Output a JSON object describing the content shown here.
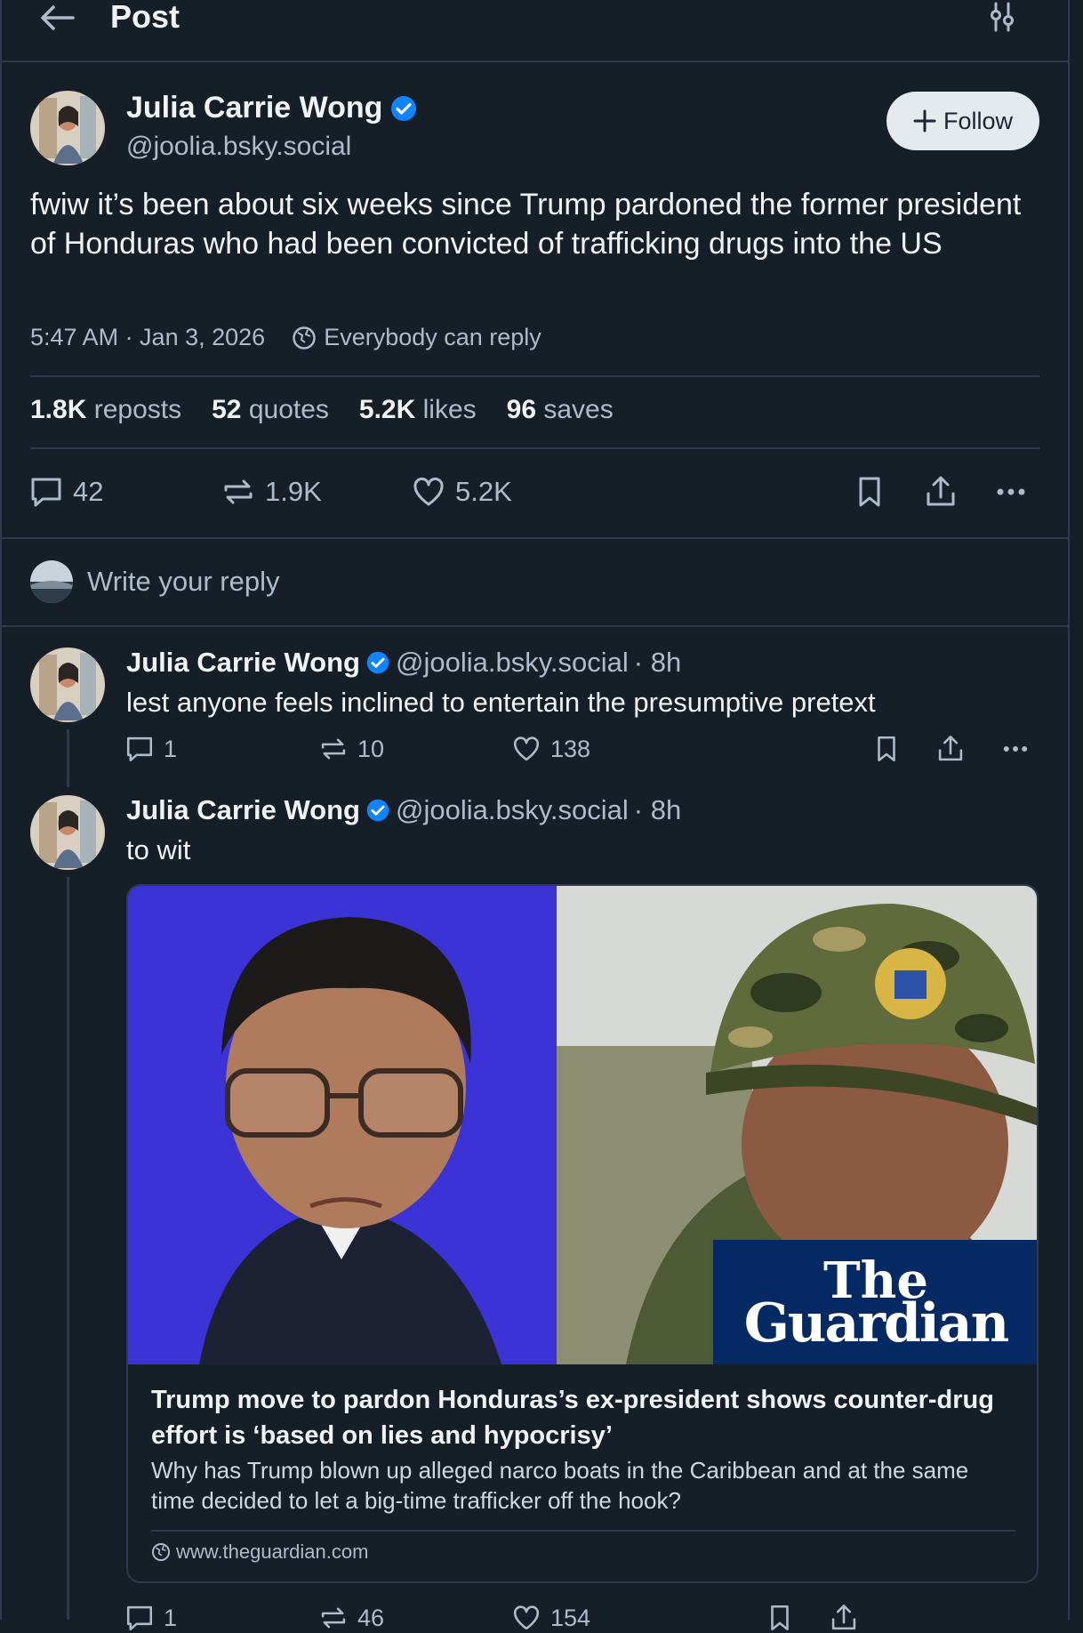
{
  "header": {
    "title": "Post"
  },
  "post": {
    "author_name": "Julia Carrie Wong",
    "author_handle": "@joolia.bsky.social",
    "follow_label": "Follow",
    "text": "fwiw it’s been about six weeks since Trump pardoned the former president of Honduras who had been convicted  of trafficking drugs into the US",
    "timestamp": "5:47 AM · Jan 3, 2026",
    "reply_setting": "Everybody can reply",
    "stats": {
      "reposts_count": "1.8K",
      "reposts_label": "reposts",
      "quotes_count": "52",
      "quotes_label": "quotes",
      "likes_count": "5.2K",
      "likes_label": "likes",
      "saves_count": "96",
      "saves_label": "saves"
    },
    "actions": {
      "replies": "42",
      "reposts": "1.9K",
      "likes": "5.2K"
    }
  },
  "compose": {
    "placeholder": "Write your reply"
  },
  "replies": [
    {
      "author_name": "Julia Carrie Wong",
      "author_handle": "@joolia.bsky.social",
      "time": "· 8h",
      "text": "lest anyone feels inclined to entertain the presumptive pretext",
      "replies": "1",
      "reposts": "10",
      "likes": "138"
    },
    {
      "author_name": "Julia Carrie Wong",
      "author_handle": "@joolia.bsky.social",
      "time": "· 8h",
      "text": "to wit",
      "embed": {
        "publisher_logo_line1": "The",
        "publisher_logo_line2": "Guardian",
        "title": "Trump move to pardon Honduras’s ex-president shows counter-drug effort is ‘based on lies and hypocrisy’",
        "description": "Why has Trump blown up alleged narco boats in the Caribbean and at the same time decided to let a big-time trafficker off the hook?",
        "domain": "www.theguardian.com"
      },
      "replies": "1",
      "reposts": "46",
      "likes": "154"
    }
  ],
  "colors": {
    "background": "#161e27",
    "accent": "#1083fe",
    "divider": "#2c3a4b",
    "logo_panel": "#052962"
  }
}
